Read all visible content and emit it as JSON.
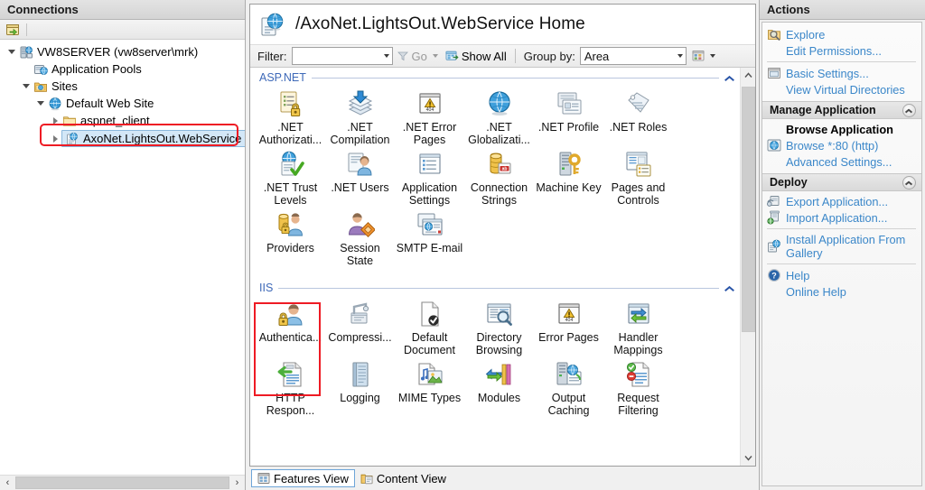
{
  "connections": {
    "title": "Connections",
    "toolbar": [
      {
        "name": "connect-to-icon",
        "tip": "Connect to"
      }
    ],
    "tree": [
      {
        "label": "VW8SERVER (vw8server\\mrk)",
        "indent": 0,
        "twist": "open",
        "icon": "server-icon"
      },
      {
        "label": "Application Pools",
        "indent": 1,
        "twist": "none",
        "icon": "app-pools-icon"
      },
      {
        "label": "Sites",
        "indent": 1,
        "twist": "open",
        "icon": "sites-folder-icon"
      },
      {
        "label": "Default Web Site",
        "indent": 2,
        "twist": "open",
        "icon": "website-globe-icon"
      },
      {
        "label": "aspnet_client",
        "indent": 3,
        "twist": "closed",
        "icon": "folder-icon"
      },
      {
        "label": "AxoNet.LightsOut.WebService",
        "indent": 3,
        "twist": "closed",
        "icon": "application-icon",
        "selected": true,
        "highlighted": true
      }
    ],
    "hscroll": {
      "left_arrow": "‹",
      "right_arrow": "›"
    }
  },
  "main": {
    "page_title": "/AxoNet.LightsOut.WebService Home",
    "page_icon": "application-home-icon",
    "filter_bar": {
      "filter_label": "Filter:",
      "filter_value": "",
      "go_label": "Go",
      "show_all_label": "Show All",
      "group_by_label": "Group by:",
      "group_by_value": "Area",
      "view_mode_icon": "view-mode-icon"
    },
    "groups": [
      {
        "name": "ASP.NET",
        "collapsed": false,
        "rows": [
          [
            {
              "label": ".NET Authorizati...",
              "icon": "net-authorization-icon"
            },
            {
              "label": ".NET Compilation",
              "icon": "net-compilation-icon"
            },
            {
              "label": ".NET Error Pages",
              "icon": "net-error-pages-icon"
            },
            {
              "label": ".NET Globalizati...",
              "icon": "net-globalization-icon"
            },
            {
              "label": ".NET Profile",
              "icon": "net-profile-icon"
            },
            {
              "label": ".NET Roles",
              "icon": "net-roles-icon"
            }
          ],
          [
            {
              "label": ".NET Trust Levels",
              "icon": "net-trust-levels-icon"
            },
            {
              "label": ".NET Users",
              "icon": "net-users-icon"
            },
            {
              "label": "Application Settings",
              "icon": "application-settings-icon"
            },
            {
              "label": "Connection Strings",
              "icon": "connection-strings-icon"
            },
            {
              "label": "Machine Key",
              "icon": "machine-key-icon"
            },
            {
              "label": "Pages and Controls",
              "icon": "pages-and-controls-icon"
            }
          ],
          [
            {
              "label": "Providers",
              "icon": "providers-icon"
            },
            {
              "label": "Session State",
              "icon": "session-state-icon"
            },
            {
              "label": "SMTP E-mail",
              "icon": "smtp-email-icon"
            }
          ]
        ]
      },
      {
        "name": "IIS",
        "collapsed": false,
        "rows": [
          [
            {
              "label": "Authentica...",
              "icon": "authentication-icon",
              "highlighted": true
            },
            {
              "label": "Compressi...",
              "icon": "compression-icon"
            },
            {
              "label": "Default Document",
              "icon": "default-document-icon"
            },
            {
              "label": "Directory Browsing",
              "icon": "directory-browsing-icon"
            },
            {
              "label": "Error Pages",
              "icon": "error-pages-icon"
            },
            {
              "label": "Handler Mappings",
              "icon": "handler-mappings-icon"
            }
          ],
          [
            {
              "label": "HTTP Respon...",
              "icon": "http-response-headers-icon"
            },
            {
              "label": "Logging",
              "icon": "logging-icon"
            },
            {
              "label": "MIME Types",
              "icon": "mime-types-icon"
            },
            {
              "label": "Modules",
              "icon": "modules-icon"
            },
            {
              "label": "Output Caching",
              "icon": "output-caching-icon"
            },
            {
              "label": "Request Filtering",
              "icon": "request-filtering-icon"
            }
          ]
        ]
      }
    ],
    "view_tabs": [
      {
        "label": "Features View",
        "icon": "features-view-icon",
        "active": true
      },
      {
        "label": "Content View",
        "icon": "content-view-icon",
        "active": false
      }
    ]
  },
  "actions": {
    "title": "Actions",
    "items": [
      {
        "type": "link",
        "label": "Explore",
        "icon": "explore-icon"
      },
      {
        "type": "link",
        "label": "Edit Permissions...",
        "icon": null
      },
      {
        "type": "separator"
      },
      {
        "type": "link",
        "label": "Basic Settings...",
        "icon": "basic-settings-icon"
      },
      {
        "type": "link",
        "label": "View Virtual Directories",
        "icon": null
      },
      {
        "type": "group",
        "label": "Manage Application",
        "collapsible": true
      },
      {
        "type": "heading",
        "label": "Browse Application"
      },
      {
        "type": "link",
        "label": "Browse *:80 (http)",
        "icon": "browse-globe-icon"
      },
      {
        "type": "link",
        "label": "Advanced Settings...",
        "icon": null
      },
      {
        "type": "group",
        "label": "Deploy",
        "collapsible": true
      },
      {
        "type": "link",
        "label": "Export Application...",
        "icon": "export-application-icon"
      },
      {
        "type": "link",
        "label": "Import Application...",
        "icon": "import-application-icon"
      },
      {
        "type": "separator"
      },
      {
        "type": "link",
        "label": "Install Application From Gallery",
        "icon": "install-from-gallery-icon"
      },
      {
        "type": "separator"
      },
      {
        "type": "link",
        "label": "Help",
        "icon": "help-icon"
      },
      {
        "type": "link",
        "label": "Online Help",
        "icon": null
      }
    ]
  },
  "colors": {
    "highlight_red": "#ee1b24",
    "link_blue": "#3b87c9",
    "group_blue": "#3e69b8",
    "selection_blue": "#d3e7f7"
  }
}
